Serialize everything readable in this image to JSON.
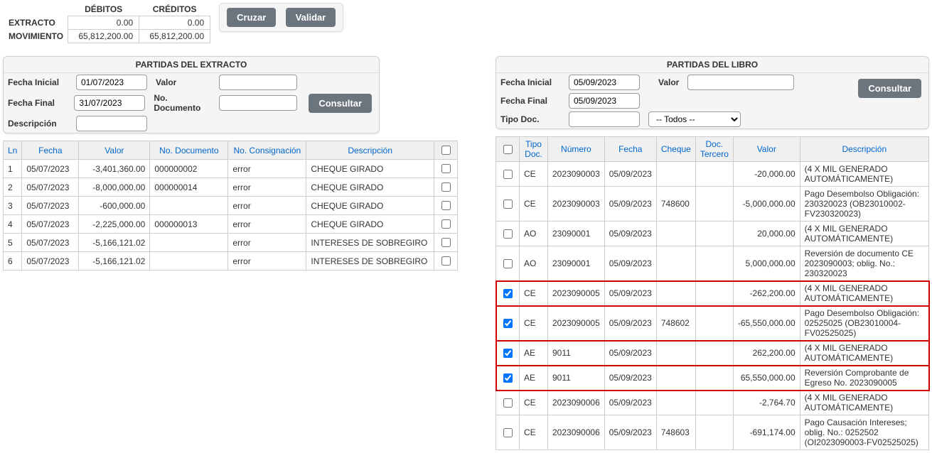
{
  "summary": {
    "headers": {
      "debitos": "DÉBITOS",
      "creditos": "CRÉDITOS"
    },
    "rows": {
      "extracto": {
        "label": "EXTRACTO",
        "debitos": "0.00",
        "creditos": "0.00"
      },
      "movimiento": {
        "label": "MOVIMIENTO",
        "debitos": "65,812,200.00",
        "creditos": "65,812,200.00"
      }
    },
    "buttons": {
      "cruzar": "Cruzar",
      "validar": "Validar"
    }
  },
  "extracto_filter": {
    "title": "PARTIDAS DEL EXTRACTO",
    "labels": {
      "fecha_ini": "Fecha Inicial",
      "fecha_fin": "Fecha Final",
      "descripcion": "Descripción",
      "valor": "Valor",
      "no_doc": "No. Documento"
    },
    "values": {
      "fecha_ini": "01/07/2023",
      "fecha_fin": "31/07/2023",
      "valor": "",
      "no_doc": "",
      "descripcion": ""
    },
    "consultar": "Consultar"
  },
  "extracto_grid": {
    "headers": {
      "ln": "Ln",
      "fecha": "Fecha",
      "valor": "Valor",
      "no_doc": "No. Documento",
      "no_cons": "No. Consignación",
      "descripcion": "Descripción"
    },
    "rows": [
      {
        "ln": "1",
        "fecha": "05/07/2023",
        "valor": "-3,401,360.00",
        "no_doc": "000000002",
        "no_cons": "error",
        "descripcion": "CHEQUE GIRADO"
      },
      {
        "ln": "2",
        "fecha": "05/07/2023",
        "valor": "-8,000,000.00",
        "no_doc": "000000014",
        "no_cons": "error",
        "descripcion": "CHEQUE GIRADO"
      },
      {
        "ln": "3",
        "fecha": "05/07/2023",
        "valor": "-600,000.00",
        "no_doc": "",
        "no_cons": "error",
        "descripcion": "CHEQUE GIRADO"
      },
      {
        "ln": "4",
        "fecha": "05/07/2023",
        "valor": "-2,225,000.00",
        "no_doc": "000000013",
        "no_cons": "error",
        "descripcion": "CHEQUE GIRADO"
      },
      {
        "ln": "5",
        "fecha": "05/07/2023",
        "valor": "-5,166,121.02",
        "no_doc": "",
        "no_cons": "error",
        "descripcion": "INTERESES DE SOBREGIRO"
      },
      {
        "ln": "6",
        "fecha": "05/07/2023",
        "valor": "-5,166,121.02",
        "no_doc": "",
        "no_cons": "error",
        "descripcion": "INTERESES DE SOBREGIRO"
      }
    ]
  },
  "libro_filter": {
    "title": "PARTIDAS DEL LIBRO",
    "labels": {
      "fecha_ini": "Fecha Inicial",
      "fecha_fin": "Fecha Final",
      "tipo_doc": "Tipo Doc.",
      "valor": "Valor"
    },
    "values": {
      "fecha_ini": "05/09/2023",
      "fecha_fin": "05/09/2023",
      "valor": "",
      "tipo_select": "-- Todos --"
    },
    "consultar": "Consultar"
  },
  "libro_grid": {
    "headers": {
      "tipo": "Tipo Doc.",
      "numero": "Número",
      "fecha": "Fecha",
      "cheque": "Cheque",
      "doc_ter": "Doc. Tercero",
      "valor": "Valor",
      "descripcion": "Descripción"
    },
    "rows": [
      {
        "chk": false,
        "hl": false,
        "tipo": "CE",
        "numero": "2023090003",
        "fecha": "05/09/2023",
        "cheque": "",
        "doc_ter": "",
        "valor": "-20,000.00",
        "descripcion": "(4 X MIL GENERADO AUTOMÁTICAMENTE)"
      },
      {
        "chk": false,
        "hl": false,
        "tipo": "CE",
        "numero": "2023090003",
        "fecha": "05/09/2023",
        "cheque": "748600",
        "doc_ter": "",
        "valor": "-5,000,000.00",
        "descripcion": "Pago Desembolso Obligación: 230320023 (OB23010002-FV230320023)"
      },
      {
        "chk": false,
        "hl": false,
        "tipo": "AO",
        "numero": "23090001",
        "fecha": "05/09/2023",
        "cheque": "",
        "doc_ter": "",
        "valor": "20,000.00",
        "descripcion": "(4 X MIL GENERADO AUTOMÁTICAMENTE)"
      },
      {
        "chk": false,
        "hl": false,
        "tipo": "AO",
        "numero": "23090001",
        "fecha": "05/09/2023",
        "cheque": "",
        "doc_ter": "",
        "valor": "5,000,000.00",
        "descripcion": "Reversión de documento CE 2023090003; oblig. No.: 230320023"
      },
      {
        "chk": true,
        "hl": true,
        "tipo": "CE",
        "numero": "2023090005",
        "fecha": "05/09/2023",
        "cheque": "",
        "doc_ter": "",
        "valor": "-262,200.00",
        "descripcion": "(4 X MIL GENERADO AUTOMÁTICAMENTE)"
      },
      {
        "chk": true,
        "hl": true,
        "tipo": "CE",
        "numero": "2023090005",
        "fecha": "05/09/2023",
        "cheque": "748602",
        "doc_ter": "",
        "valor": "-65,550,000.00",
        "descripcion": "Pago Desembolso Obligación: 02525025 (OB23010004-FV02525025)"
      },
      {
        "chk": true,
        "hl": true,
        "tipo": "AE",
        "numero": "9011",
        "fecha": "05/09/2023",
        "cheque": "",
        "doc_ter": "",
        "valor": "262,200.00",
        "descripcion": "(4 X MIL GENERADO AUTOMÁTICAMENTE)"
      },
      {
        "chk": true,
        "hl": true,
        "tipo": "AE",
        "numero": "9011",
        "fecha": "05/09/2023",
        "cheque": "",
        "doc_ter": "",
        "valor": "65,550,000.00",
        "descripcion": "Reversión Comprobante de Egreso No. 2023090005"
      },
      {
        "chk": false,
        "hl": false,
        "tipo": "CE",
        "numero": "2023090006",
        "fecha": "05/09/2023",
        "cheque": "",
        "doc_ter": "",
        "valor": "-2,764.70",
        "descripcion": "(4 X MIL GENERADO AUTOMÁTICAMENTE)"
      },
      {
        "chk": false,
        "hl": false,
        "tipo": "CE",
        "numero": "2023090006",
        "fecha": "05/09/2023",
        "cheque": "748603",
        "doc_ter": "",
        "valor": "-691,174.00",
        "descripcion": "Pago Causación Intereses; oblig. No.: 0252502  (OI2023090003-FV02525025)"
      }
    ]
  }
}
